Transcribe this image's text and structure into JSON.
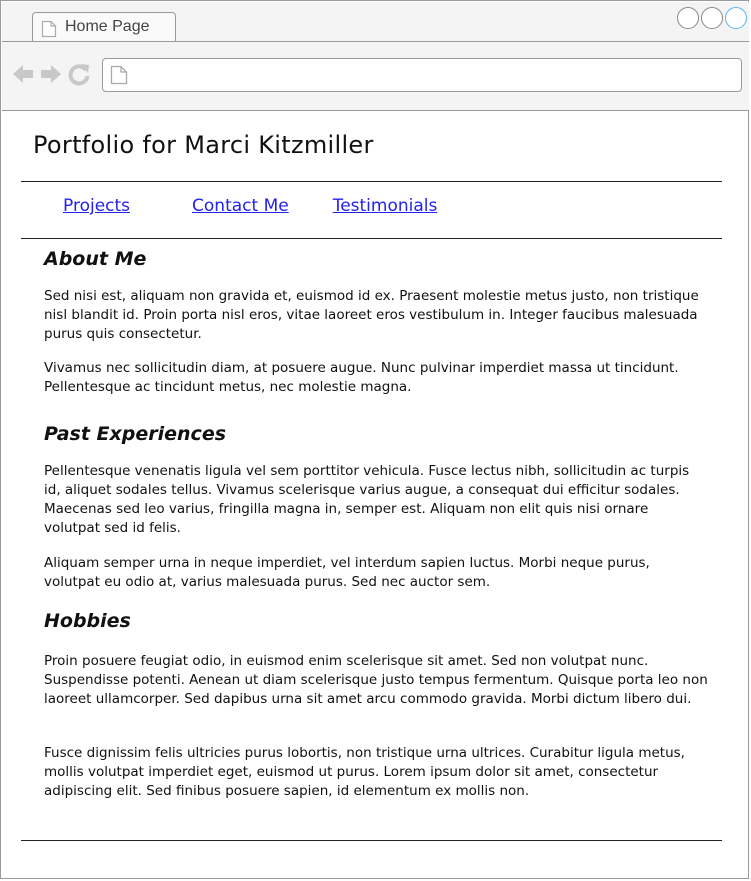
{
  "browser": {
    "tab_title": "Home Page",
    "address": "",
    "icons": {
      "tab": "page-icon",
      "back": "back-arrow-icon",
      "forward": "forward-arrow-icon",
      "reload": "reload-icon",
      "address": "page-icon",
      "window_buttons": [
        "window-button-icon",
        "window-button-icon",
        "window-button-icon"
      ]
    }
  },
  "page": {
    "title": "Portfolio for Marci Kitzmiller",
    "nav": [
      {
        "label": "Projects"
      },
      {
        "label": "Contact Me"
      },
      {
        "label": "Testimonials"
      }
    ],
    "sections": [
      {
        "heading": "About Me",
        "paragraphs": [
          "Sed nisi est, aliquam non gravida et, euismod id ex. Praesent molestie metus justo, non tristique nisl blandit id. Proin porta nisl eros, vitae laoreet eros vestibulum in. Integer faucibus malesuada purus quis consectetur.",
          "Vivamus nec sollicitudin diam, at posuere augue. Nunc pulvinar imperdiet massa ut tincidunt. Pellentesque ac tincidunt metus, nec molestie magna."
        ]
      },
      {
        "heading": "Past Experiences",
        "paragraphs": [
          "Pellentesque venenatis ligula vel sem porttitor vehicula. Fusce lectus nibh, sollicitudin ac turpis id, aliquet sodales tellus. Vivamus scelerisque varius augue, a consequat dui efficitur sodales. Maecenas sed leo varius, fringilla magna in, semper est. Aliquam non elit quis nisi ornare volutpat sed id felis.",
          "Aliquam semper urna in neque imperdiet, vel interdum sapien luctus. Morbi neque purus, volutpat eu odio at, varius malesuada purus. Sed nec auctor sem."
        ]
      },
      {
        "heading": "Hobbies",
        "paragraphs": [
          "Proin posuere feugiat odio, in euismod enim scelerisque sit amet. Sed non volutpat nunc. Suspendisse potenti. Aenean ut diam scelerisque justo tempus fermentum. Quisque porta leo non laoreet ullamcorper. Sed dapibus urna sit amet arcu commodo gravida. Morbi dictum libero dui.",
          "Fusce dignissim felis ultricies purus lobortis, non tristique urna ultrices. Curabitur ligula metus, mollis volutpat imperdiet eget, euismod ut purus. Lorem ipsum dolor sit amet, consectetur adipiscing elit. Sed finibus posuere sapien, id elementum ex mollis non."
        ]
      }
    ]
  },
  "colors": {
    "link": "#2222ee",
    "text": "#111111",
    "chrome_bg": "#f4f4f4",
    "chrome_border": "#9a9a9a",
    "active_window_button": "#57b6ec"
  }
}
